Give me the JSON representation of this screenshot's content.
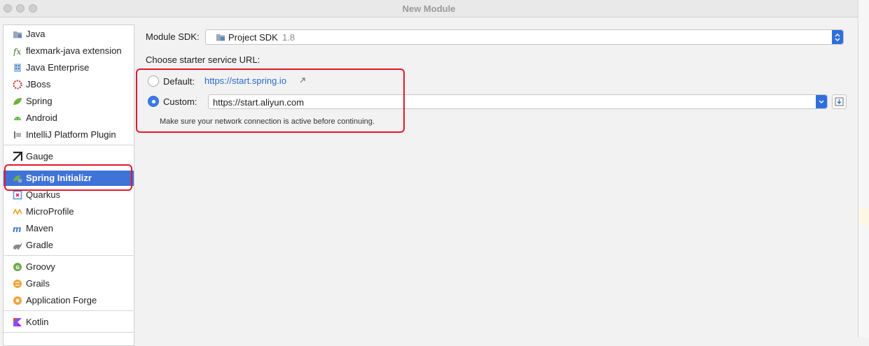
{
  "window": {
    "title": "New Module"
  },
  "sidebar": {
    "groups": [
      [
        {
          "label": "Java",
          "icon": "folder-icon"
        },
        {
          "label": "flexmark-java extension",
          "icon": "flexmark-icon"
        },
        {
          "label": "Java Enterprise",
          "icon": "java-enterprise-icon"
        },
        {
          "label": "JBoss",
          "icon": "jboss-icon"
        },
        {
          "label": "Spring",
          "icon": "spring-leaf-icon"
        },
        {
          "label": "Android",
          "icon": "android-icon"
        },
        {
          "label": "IntelliJ Platform Plugin",
          "icon": "plugin-icon"
        }
      ],
      [
        {
          "label": "Gauge",
          "icon": "gauge-icon"
        },
        {
          "label": "Spring Initializr",
          "icon": "spring-initializr-icon",
          "selected": true
        },
        {
          "label": "Quarkus",
          "icon": "quarkus-icon"
        },
        {
          "label": "MicroProfile",
          "icon": "microprofile-icon"
        },
        {
          "label": "Maven",
          "icon": "maven-icon"
        },
        {
          "label": "Gradle",
          "icon": "gradle-icon"
        }
      ],
      [
        {
          "label": "Groovy",
          "icon": "groovy-icon"
        },
        {
          "label": "Grails",
          "icon": "grails-icon"
        },
        {
          "label": "Application Forge",
          "icon": "application-forge-icon"
        }
      ],
      [
        {
          "label": "Kotlin",
          "icon": "kotlin-icon"
        }
      ]
    ]
  },
  "main": {
    "sdk_label": "Module SDK:",
    "sdk_value": "Project SDK",
    "sdk_version": "1.8",
    "starter_label": "Choose starter service URL:",
    "default_label": "Default:",
    "default_url": "https://start.spring.io",
    "custom_label": "Custom:",
    "custom_url": "https://start.aliyun.com",
    "hint": "Make sure your network connection is active before continuing."
  },
  "colors": {
    "selection": "#3f73d7",
    "link": "#2a6acb",
    "annotation": "#e0192d"
  }
}
